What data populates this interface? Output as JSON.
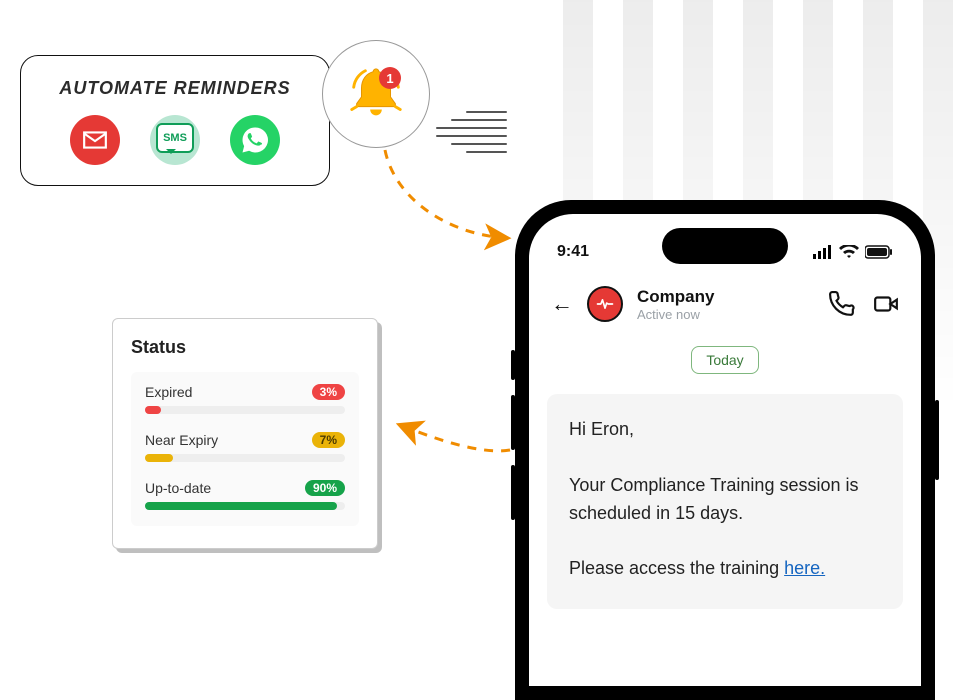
{
  "reminders": {
    "title": "AUTOMATE REMINDERS",
    "sms_label": "SMS",
    "badge": "1"
  },
  "status": {
    "title": "Status",
    "rows": [
      {
        "label": "Expired",
        "pct": "3%",
        "width": 8
      },
      {
        "label": "Near Expiry",
        "pct": "7%",
        "width": 14
      },
      {
        "label": "Up-to-date",
        "pct": "90%",
        "width": 96
      }
    ]
  },
  "phone": {
    "time": "9:41",
    "company": "Company",
    "presence": "Active now",
    "today": "Today",
    "msg_greeting": "Hi Eron,",
    "msg_body": "Your Compliance Training session is scheduled in 15 days.",
    "msg_cta_prefix": "Please access the training ",
    "msg_link": "here."
  }
}
